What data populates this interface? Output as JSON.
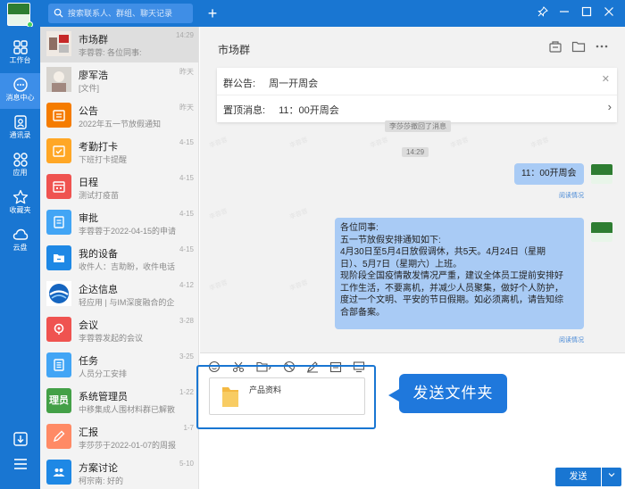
{
  "topbar": {
    "search_placeholder": "搜索联系人、群组、聊天记录"
  },
  "nav": {
    "items": [
      {
        "label": "工作台",
        "icon": "grid-icon"
      },
      {
        "label": "消息中心",
        "icon": "chat-icon"
      },
      {
        "label": "通讯录",
        "icon": "contacts-icon"
      },
      {
        "label": "应用",
        "icon": "apps-icon"
      },
      {
        "label": "收藏夹",
        "icon": "star-icon"
      },
      {
        "label": "云盘",
        "icon": "cloud-icon"
      }
    ]
  },
  "conversations": [
    {
      "name": "市场群",
      "preview": "李蓉蓉: 各位同事:",
      "time": "14:29",
      "color": "#8d6e63",
      "avatar_text": ""
    },
    {
      "name": "廖军浩",
      "preview": "[文件]",
      "time": "昨天",
      "color": "#9e9e9e",
      "avatar_text": ""
    },
    {
      "name": "公告",
      "preview": "2022年五一节放假通知",
      "time": "昨天",
      "color": "#f57c00",
      "avatar_text": ""
    },
    {
      "name": "考勤打卡",
      "preview": "下班打卡提醒",
      "time": "4-15",
      "color": "#ffa726",
      "avatar_text": ""
    },
    {
      "name": "日程",
      "preview": "测试打疫苗",
      "time": "4-15",
      "color": "#ef5350",
      "avatar_text": ""
    },
    {
      "name": "审批",
      "preview": "李蓉蓉于2022-04-15的申请",
      "time": "4-15",
      "color": "#42a5f5",
      "avatar_text": ""
    },
    {
      "name": "我的设备",
      "preview": "收件人：吉助盼，收件电话",
      "time": "4-15",
      "color": "#1e88e5",
      "avatar_text": ""
    },
    {
      "name": "企达信息",
      "preview": "轻应用 | 与IM深度融合的企",
      "time": "4-12",
      "color": "#0d47a1",
      "avatar_text": ""
    },
    {
      "name": "会议",
      "preview": "李蓉蓉发起的会议",
      "time": "3-28",
      "color": "#ef5350",
      "avatar_text": ""
    },
    {
      "name": "任务",
      "preview": "人员分工安排",
      "time": "3-25",
      "color": "#42a5f5",
      "avatar_text": ""
    },
    {
      "name": "系统管理员",
      "preview": "中移集成人围材料群已解散",
      "time": "1-22",
      "color": "#43a047",
      "avatar_text": "理员"
    },
    {
      "name": "汇报",
      "preview": "李莎莎于2022-01-07的周报",
      "time": "1-7",
      "color": "#ff8a65",
      "avatar_text": ""
    },
    {
      "name": "方案讨论",
      "preview": "柯宗南: 好的",
      "time": "5-10",
      "color": "#1e88e5",
      "avatar_text": ""
    }
  ],
  "chat": {
    "title": "市场群",
    "notice_label": "群公告:",
    "notice_text": "周一开周会",
    "pinned_label": "置顶消息:",
    "pinned_text": "11：00开周会",
    "system_msg": "李莎莎撤回了消息",
    "time_marker": "14:29",
    "messages": [
      {
        "text": "11：00开周会",
        "read": "阅读情况"
      },
      {
        "lines": [
          "各位同事:",
          "五一节放假安排通知如下:",
          "4月30日至5月4日放假调休，共5天。4月24日（星期",
          "日）、5月7日（星期六）上班。",
          "现阶段全国疫情散发情况严重，建议全体员工提前安排好",
          "工作生活，不要离机，并减少人员聚集，做好个人防护，",
          "度过一个文明、平安的节日假期。如必须离机，请告知综",
          "合部备案。"
        ],
        "read": "阅读情况"
      }
    ],
    "watermark": "李蓉蓉"
  },
  "composer": {
    "file_name": "产品资料",
    "callout": "发送文件夹",
    "send_label": "发送"
  }
}
